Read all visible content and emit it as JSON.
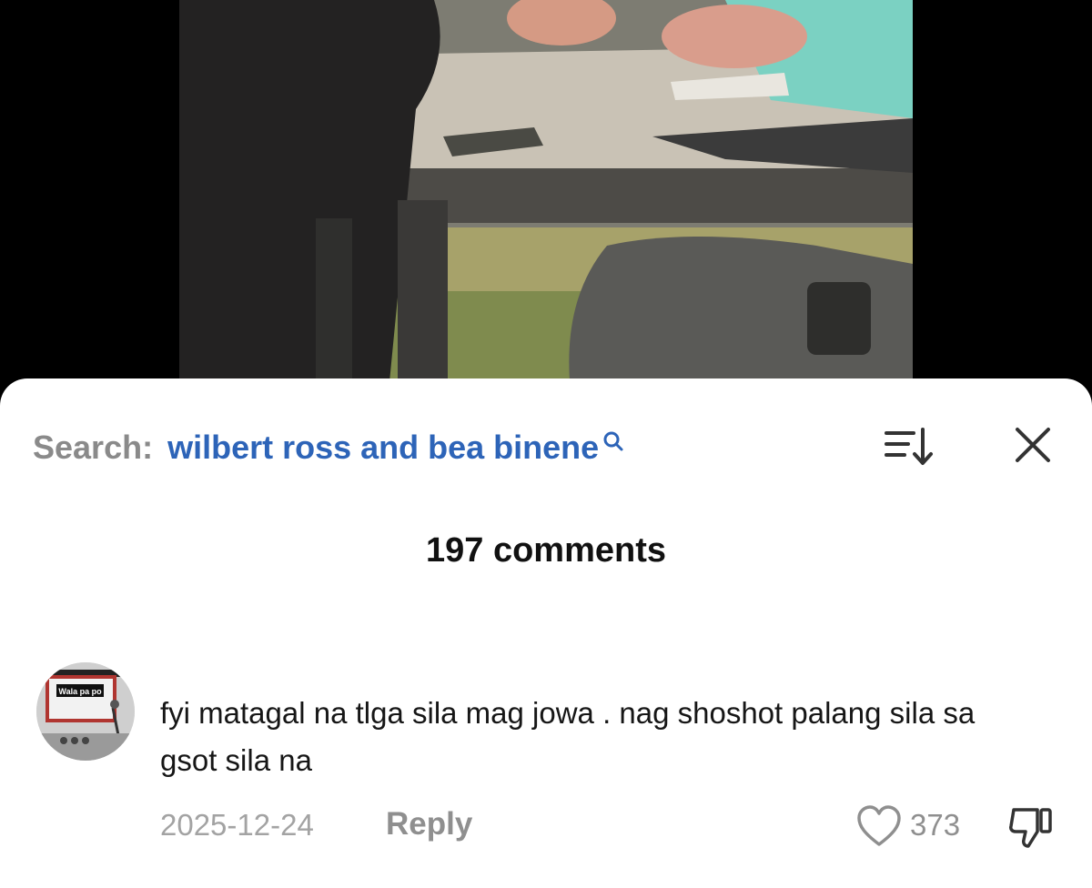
{
  "video": {
    "description_icon": "video-frame"
  },
  "search": {
    "prefix": "Search:",
    "query": "wilbert ross and bea binene",
    "icon": "search-icon"
  },
  "toolbar": {
    "sort_icon": "sort-icon",
    "close_icon": "close-icon"
  },
  "comments": {
    "count_label": "197 comments",
    "items": [
      {
        "avatar_text": "Wala pa po",
        "text": "fyi matagal na tlga sila mag jowa . nag shoshot palang sila sa gsot sila na",
        "date": "2025-12-24",
        "reply_label": "Reply",
        "likes": "373",
        "like_icon": "heart-icon",
        "dislike_icon": "thumbs-down-icon"
      }
    ]
  },
  "colors": {
    "accent": "#2d64b8",
    "muted": "#8f8f8f",
    "background": "#ffffff"
  }
}
